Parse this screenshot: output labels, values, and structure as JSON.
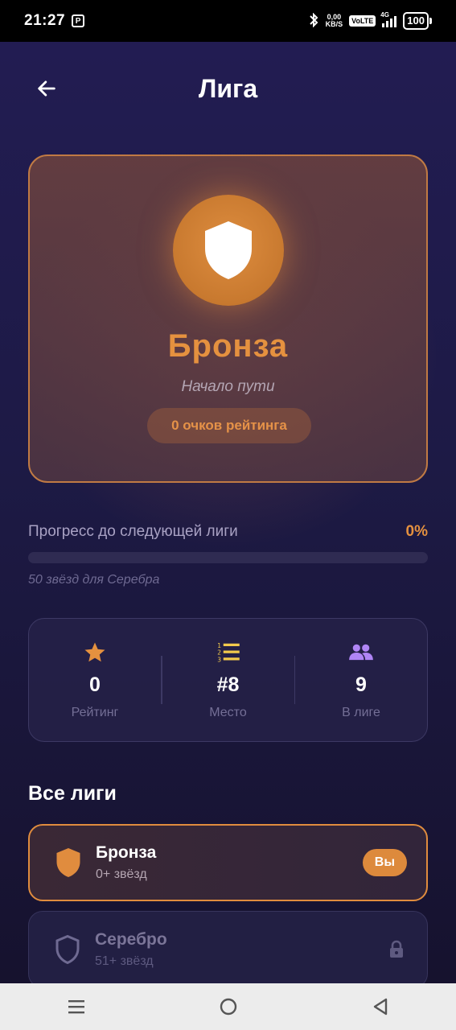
{
  "status": {
    "time": "21:27",
    "app_icon": "P",
    "net_speed_top": "0,00",
    "net_speed_bottom": "KB/S",
    "volte": "VoLTE",
    "network": "4G",
    "battery": "100",
    "icons": [
      "bluetooth-icon",
      "signal-icon",
      "battery-icon"
    ]
  },
  "header": {
    "title": "Лига",
    "back_icon": "arrow-left-icon"
  },
  "current_league": {
    "name": "Бронза",
    "subtitle": "Начало пути",
    "points": "0 очков рейтинга",
    "icon": "shield-icon",
    "accent": "#e5913f"
  },
  "progress": {
    "label": "Прогресс до следующей лиги",
    "percent_text": "0%",
    "percent": 0,
    "hint": "50 звёзд для Серебра"
  },
  "stats": [
    {
      "icon": "star-icon",
      "value": "0",
      "label": "Рейтинг",
      "color": "#e5913f"
    },
    {
      "icon": "numbered-list-icon",
      "value": "#8",
      "label": "Место",
      "color": "#f2c94c"
    },
    {
      "icon": "people-icon",
      "value": "9",
      "label": "В лиге",
      "color": "#b085f5"
    }
  ],
  "all_leagues": {
    "title": "Все лиги",
    "items": [
      {
        "name": "Бронза",
        "requirement": "0+ звёзд",
        "badge": "Вы",
        "state": "current",
        "icon": "shield-icon"
      },
      {
        "name": "Серебро",
        "requirement": "51+ звёзд",
        "state": "locked",
        "icon": "shield-outline-icon",
        "lock_icon": "lock-icon"
      }
    ]
  },
  "navbar": {
    "buttons": [
      "menu-icon",
      "home-circle-icon",
      "back-triangle-icon"
    ]
  }
}
